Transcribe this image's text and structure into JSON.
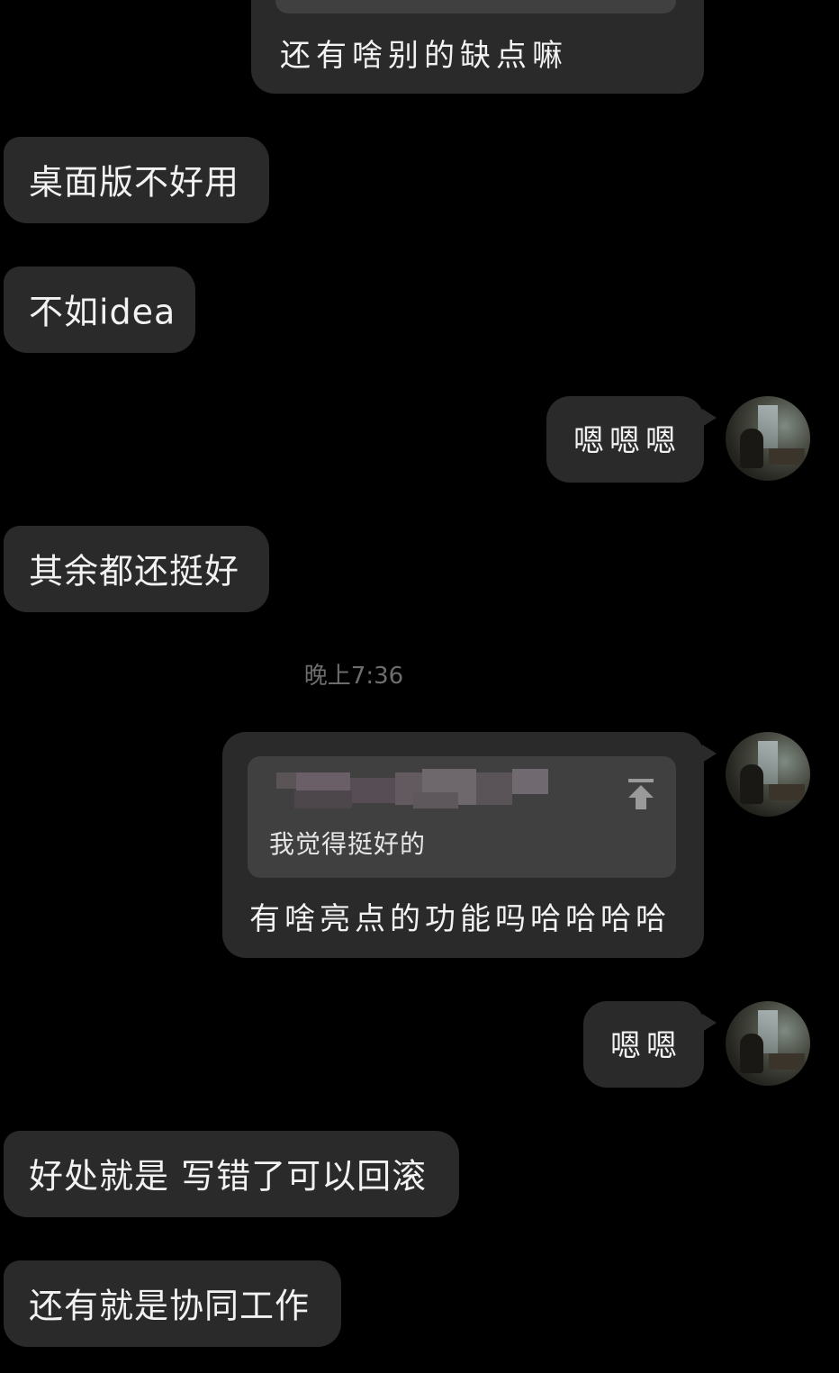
{
  "conversation": {
    "timestamp": "晚上7:36",
    "messages": [
      {
        "id": "m1",
        "direction": "outgoing",
        "text": "还有啥别的缺点嘛",
        "has_quote_strip": true
      },
      {
        "id": "m2",
        "direction": "incoming",
        "text": "桌面版不好用"
      },
      {
        "id": "m3",
        "direction": "incoming",
        "text": "不如idea"
      },
      {
        "id": "m4",
        "direction": "outgoing",
        "text": "嗯嗯嗯"
      },
      {
        "id": "m5",
        "direction": "incoming",
        "text": "其余都还挺好"
      },
      {
        "id": "m6",
        "direction": "outgoing",
        "text": "有啥亮点的功能吗哈哈哈哈",
        "quote": {
          "header_partial": "上7:34",
          "text": "我觉得挺好的",
          "icon": "pin-top-icon"
        }
      },
      {
        "id": "m7",
        "direction": "outgoing",
        "text": "嗯嗯"
      },
      {
        "id": "m8",
        "direction": "incoming",
        "text": "好处就是 写错了可以回滚"
      },
      {
        "id": "m9",
        "direction": "incoming",
        "text": "还有就是协同工作"
      }
    ]
  },
  "colors": {
    "background": "#000000",
    "bubble": "#2a2a2a",
    "quote": "#404040",
    "timestamp": "#6d6d6d"
  }
}
